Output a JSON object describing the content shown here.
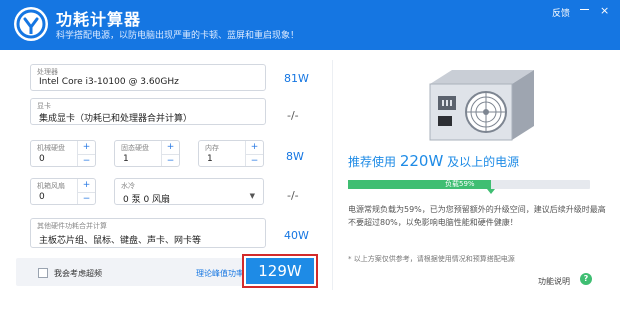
{
  "header": {
    "title": "功耗计算器",
    "subtitle": "科学搭配电源，以防电脑出现严重的卡顿、蓝屏和重启现象！",
    "feedback": "反馈",
    "close": "×"
  },
  "fields": {
    "cpu": {
      "label": "处理器",
      "value": "Intel Core i3-10100 @ 3.60GHz",
      "watt": "81W"
    },
    "gpu": {
      "label": "显卡",
      "value": "集成显卡（功耗已和处理器合并计算）",
      "watt": "-/-"
    },
    "hdd": {
      "label": "机械硬盘",
      "value": "0"
    },
    "ssd": {
      "label": "固态硬盘",
      "value": "1"
    },
    "ram": {
      "label": "内存",
      "value": "1",
      "watt": "8W"
    },
    "fan": {
      "label": "机箱风扇",
      "value": "0"
    },
    "water": {
      "label": "水冷",
      "value": "0 泵 0 风扇",
      "watt": "-/-"
    },
    "other": {
      "label": "其他硬件功耗合并计算",
      "value": "主板芯片组、鼠标、键盘、声卡、网卡等",
      "watt": "40W"
    },
    "stepper_plus": "+",
    "stepper_minus": "−"
  },
  "bottom": {
    "overclock_label": "我会考虑超频",
    "peak_link": "理论峰值功率",
    "total": "129W"
  },
  "recommend": {
    "prefix": "推荐使用",
    "watt": "220W",
    "suffix": "及以上的电源",
    "load_label": "负载59%",
    "load_fraction": 0.59,
    "advice": "电源常规负载为59%，已为您预留额外的升级空间，建议后续升级时最高不要超过80%，以免影响电脑性能和硬件健康！",
    "note": "* 以上方案仅供参考，请根据使用情况和预算搭配电源",
    "help_label": "功能说明",
    "help_icon": "?"
  },
  "colors": {
    "brand": "#1576e2",
    "button": "#1e8be6",
    "load": "#3fbe72",
    "highlight": "#d32a2a"
  }
}
